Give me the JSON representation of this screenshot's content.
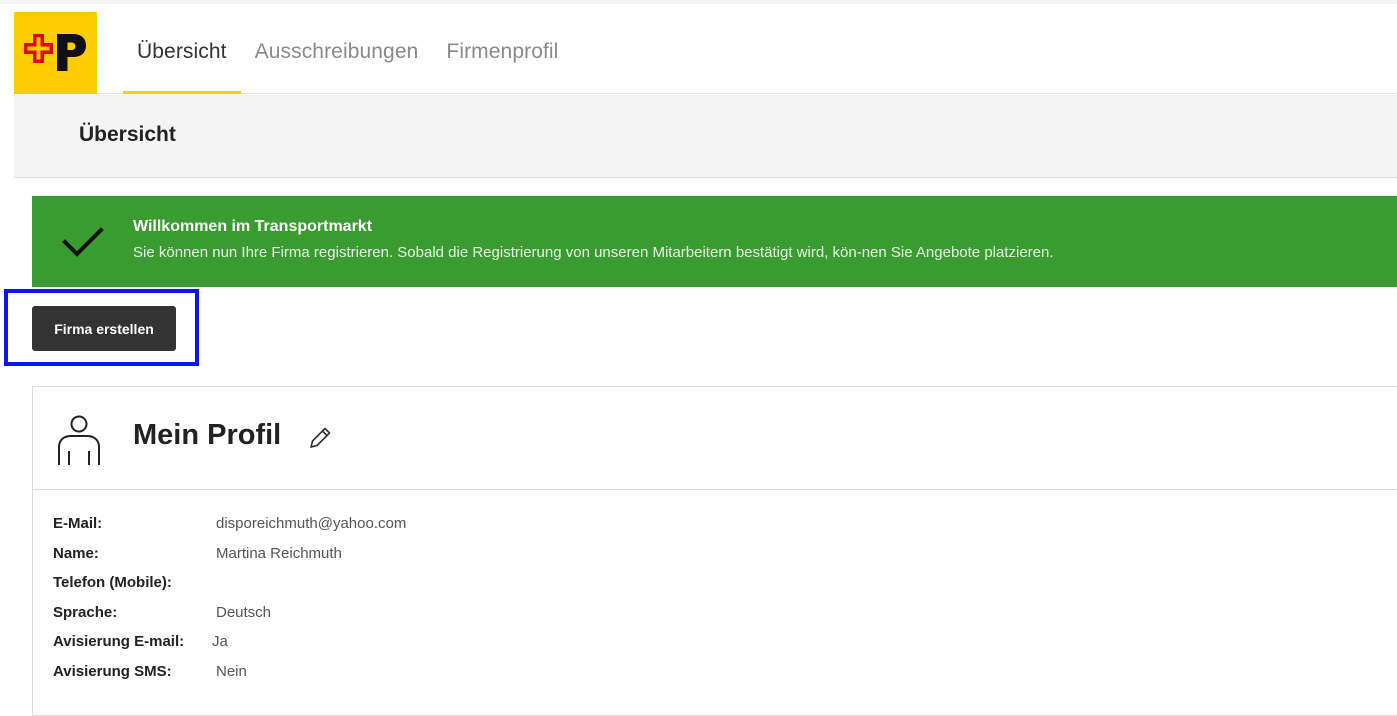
{
  "colors": {
    "brand_yellow": "#ffcc00",
    "brand_red": "#e30613",
    "success_green": "#3a9c30",
    "primary_button": "#333333",
    "highlight_box": "#0a17e6"
  },
  "logo": {
    "icon": "swiss-post-logo"
  },
  "nav": {
    "tabs": [
      {
        "label": "Übersicht",
        "active": true
      },
      {
        "label": "Ausschreibungen",
        "active": false
      },
      {
        "label": "Firmenprofil",
        "active": false
      }
    ]
  },
  "page": {
    "title": "Übersicht"
  },
  "banner": {
    "icon": "checkmark-icon",
    "title": "Willkommen im Transportmarkt",
    "text": "Sie können nun Ihre Firma registrieren. Sobald die Registrierung von unseren Mitarbeitern bestätigt wird, kön-nen Sie Angebote platzieren."
  },
  "actions": {
    "create_company_label": "Firma erstellen"
  },
  "profile": {
    "title": "Mein Profil",
    "icons": {
      "avatar": "person-icon",
      "edit": "pencil-icon"
    },
    "fields": [
      {
        "label": "E-Mail:",
        "value": "disporeichmuth@yahoo.com"
      },
      {
        "label": "Name:",
        "value": "Martina Reichmuth"
      },
      {
        "label": "Telefon (Mobile):",
        "value": ""
      },
      {
        "label": "Sprache:",
        "value": "Deutsch"
      },
      {
        "label": "Avisierung E-mail:",
        "value": "Ja"
      },
      {
        "label": "Avisierung SMS:",
        "value": "Nein"
      }
    ]
  }
}
